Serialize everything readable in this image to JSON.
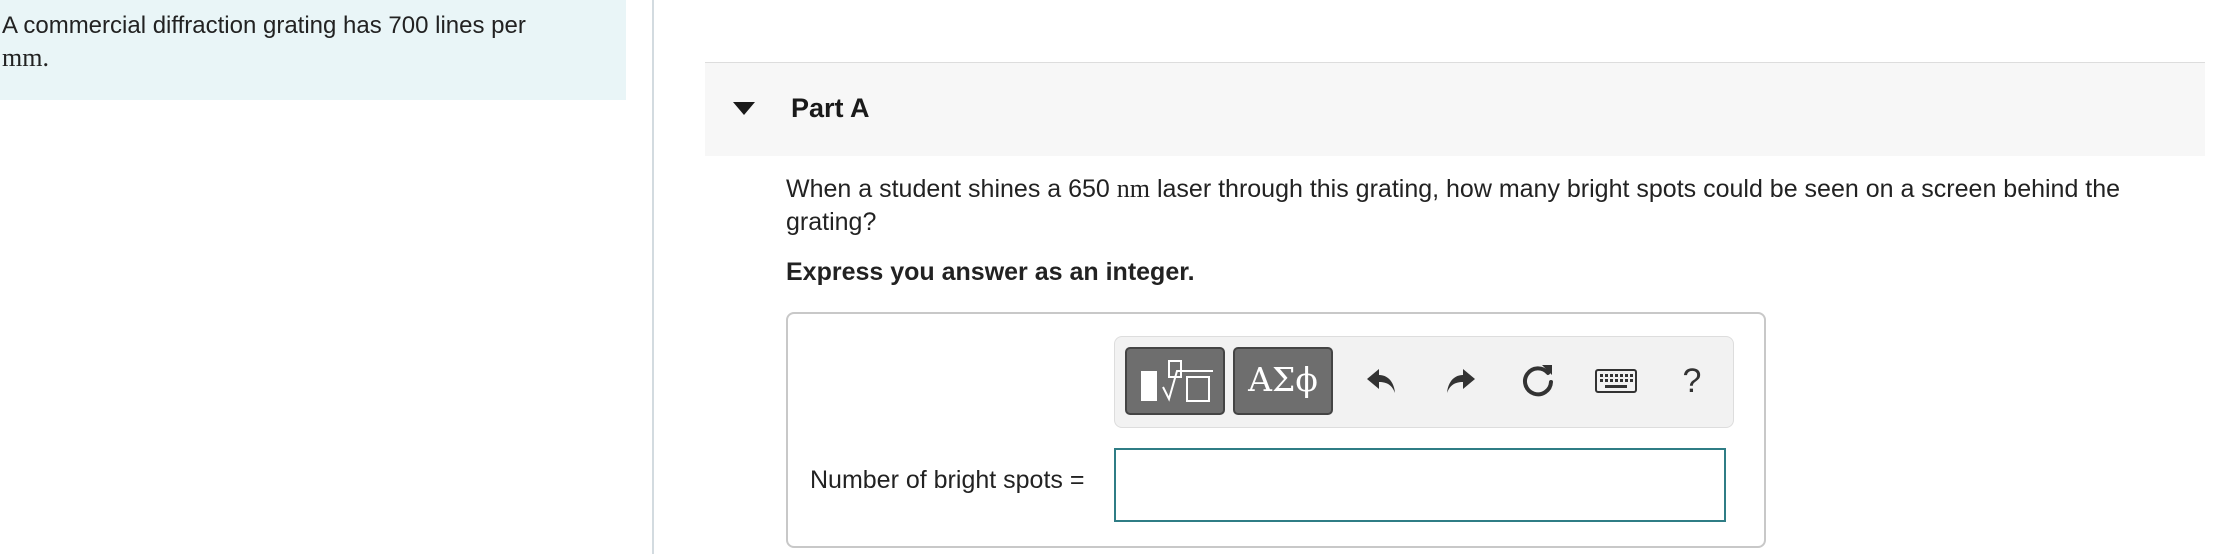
{
  "intro": {
    "text_before": "A commercial diffraction grating has 700 lines per ",
    "unit": "mm",
    "text_after": "."
  },
  "part": {
    "title": "Part A"
  },
  "question": {
    "text_before": "When a student shines a 650 ",
    "unit": "nm",
    "text_after": " laser through this grating, how many bright spots could be seen on a screen behind the grating?"
  },
  "instruction": "Express you answer as an integer.",
  "answer": {
    "label": "Number of bright spots =",
    "value": ""
  },
  "toolbar": {
    "symbols_label": "ΑΣϕ",
    "help_label": "?",
    "icons": [
      "templates-icon",
      "greek-symbols-icon",
      "undo-icon",
      "redo-icon",
      "reset-icon",
      "keyboard-icon",
      "help-icon"
    ]
  },
  "colors": {
    "intro_bg": "#e9f5f7",
    "header_bg": "#f7f7f7",
    "input_border": "#2f7d85",
    "toolbar_button": "#6e6e6e"
  }
}
